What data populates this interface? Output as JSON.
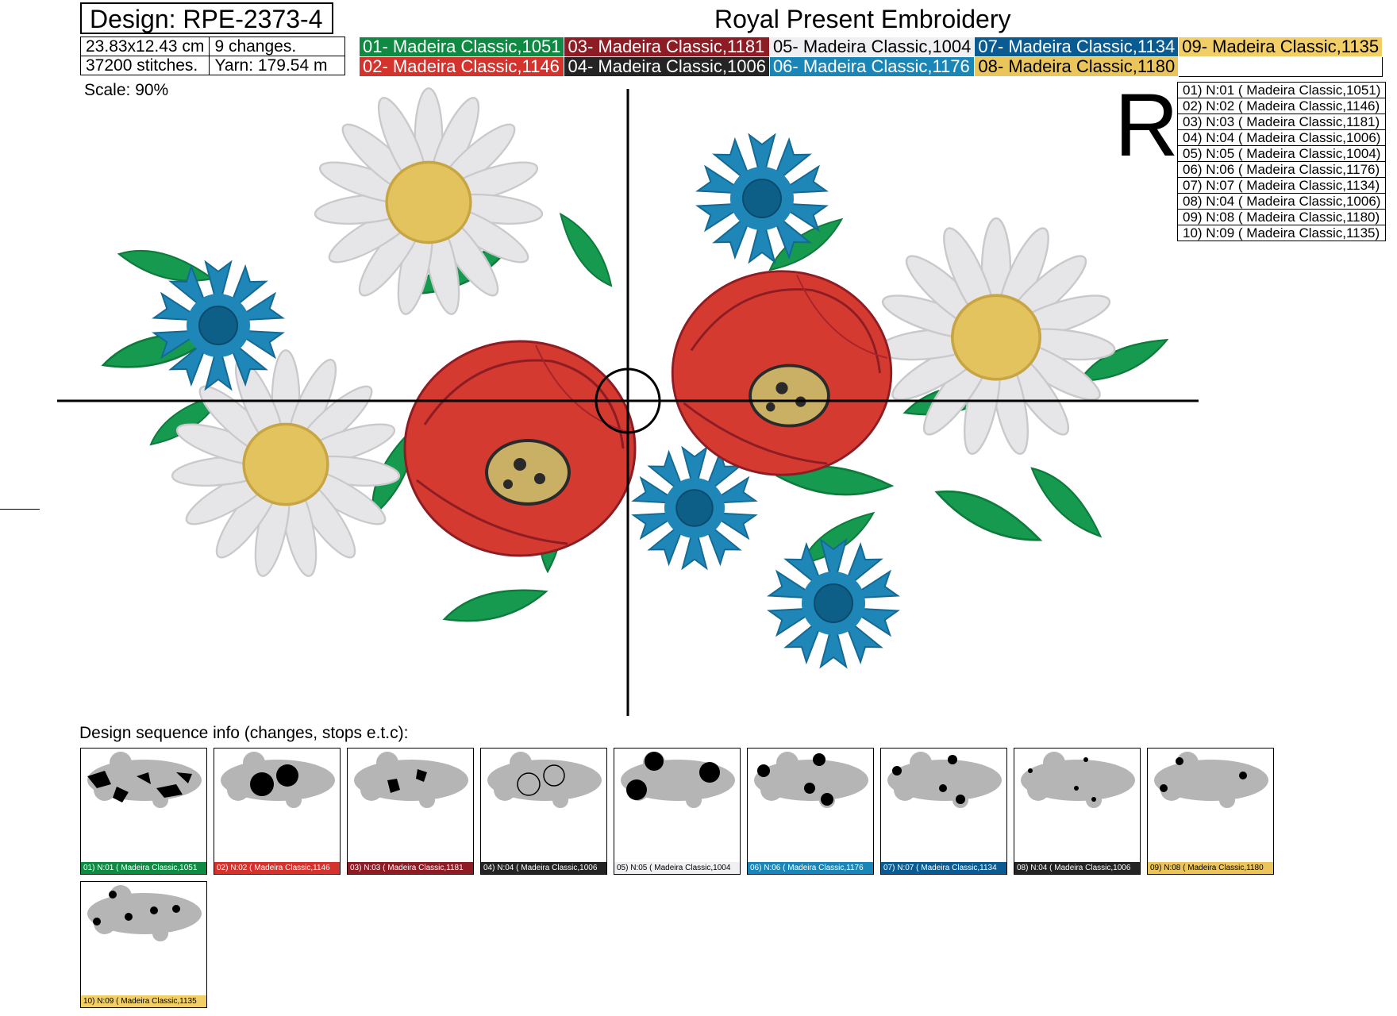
{
  "header": {
    "design": "Design: RPE-2373-4",
    "brand": "Royal Present Embroidery",
    "size": "23.83x12.43 cm",
    "changes": "9 changes.",
    "stitches": "37200 stitches.",
    "yarn": "Yarn: 179.54 m"
  },
  "palette": [
    {
      "label": "01- Madeira Classic,1051",
      "color": "#0e8a43",
      "text": "#ffffff"
    },
    {
      "label": "02- Madeira Classic,1146",
      "color": "#d4322c",
      "text": "#ffffff"
    },
    {
      "label": "03- Madeira Classic,1181",
      "color": "#8e1c24",
      "text": "#ffffff"
    },
    {
      "label": "04- Madeira Classic,1006",
      "color": "#242424",
      "text": "#ffffff"
    },
    {
      "label": "05- Madeira Classic,1004",
      "color": "#f0f0f2",
      "text": "#000000"
    },
    {
      "label": "06- Madeira Classic,1176",
      "color": "#1a86b8",
      "text": "#ffffff"
    },
    {
      "label": "07- Madeira Classic,1134",
      "color": "#0a5b92",
      "text": "#ffffff"
    },
    {
      "label": "08- Madeira Classic,1180",
      "color": "#eac55c",
      "text": "#000000"
    },
    {
      "label": "09- Madeira Classic,1135",
      "color": "#f2cf66",
      "text": "#000000"
    }
  ],
  "scale": "Scale: 90%",
  "r_letter": "R",
  "sequence_list": [
    "01) N:01 ( Madeira Classic,1051)",
    "02) N:02 ( Madeira Classic,1146)",
    "03) N:03 ( Madeira Classic,1181)",
    "04) N:04 ( Madeira Classic,1006)",
    "05) N:05 ( Madeira Classic,1004)",
    "06) N:06 ( Madeira Classic,1176)",
    "07) N:07 ( Madeira Classic,1134)",
    "08) N:04 ( Madeira Classic,1006)",
    "09) N:08 ( Madeira Classic,1180)",
    "10) N:09 ( Madeira Classic,1135)"
  ],
  "sequence_title": "Design sequence info (changes, stops e.t.c):",
  "thumbnails": [
    {
      "caption": "01) N:01 ( Madeira Classic,1051",
      "color": "#0e8a43",
      "text": "#ffffff"
    },
    {
      "caption": "02) N:02 ( Madeira Classic,1146",
      "color": "#d4322c",
      "text": "#ffffff"
    },
    {
      "caption": "03) N:03 ( Madeira Classic,1181",
      "color": "#8e1c24",
      "text": "#ffffff"
    },
    {
      "caption": "04) N:04 ( Madeira Classic,1006",
      "color": "#242424",
      "text": "#ffffff"
    },
    {
      "caption": "05) N:05 ( Madeira Classic,1004",
      "color": "#f0f0f2",
      "text": "#000000"
    },
    {
      "caption": "06) N:06 ( Madeira Classic,1176",
      "color": "#1a86b8",
      "text": "#ffffff"
    },
    {
      "caption": "07) N:07 ( Madeira Classic,1134",
      "color": "#0a5b92",
      "text": "#ffffff"
    },
    {
      "caption": "08) N:04 ( Madeira Classic,1006",
      "color": "#242424",
      "text": "#ffffff"
    },
    {
      "caption": "09) N:08 ( Madeira Classic,1180",
      "color": "#eac55c",
      "text": "#000000"
    },
    {
      "caption": "10) N:09 ( Madeira Classic,1135",
      "color": "#f2cf66",
      "text": "#000000"
    }
  ]
}
